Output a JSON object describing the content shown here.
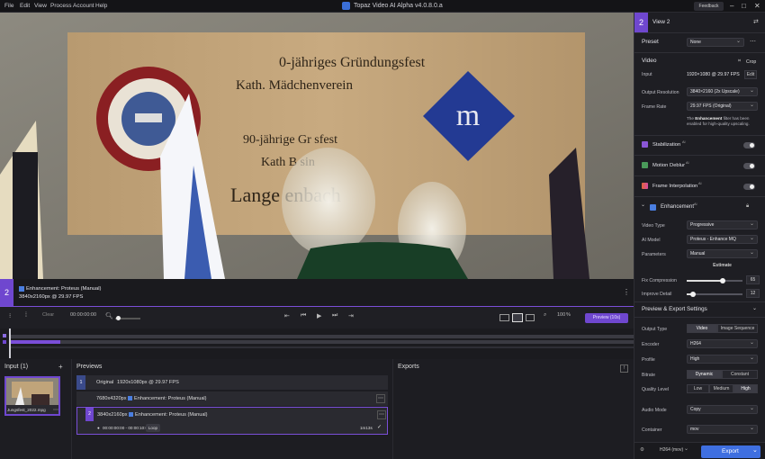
{
  "menu": [
    "File",
    "Edit",
    "View",
    "Process",
    "Account",
    "Help"
  ],
  "app_title": "Topaz Video AI Alpha  v4.0.8.0.a",
  "feedback_label": "Feedback",
  "info_bar": {
    "number": "2",
    "model_line": "Enhancement: Proteus (Manual)",
    "res_line": "3840x2160px @ 29.97 FPS"
  },
  "controls": {
    "clear_label": "Clear",
    "timecode": "00:00:00:00",
    "zoom": "100",
    "zoom_unit": "%",
    "preview_button": "Preview (10s)"
  },
  "timeline": {
    "progress": 0.082
  },
  "input_panel": {
    "title": "Input (1)",
    "file_name": "Jungsfest_2022.mpg"
  },
  "previews_panel": {
    "title": "Previews",
    "original": {
      "num": "1",
      "label": "Original",
      "res": "1920x1080px @ 29.97 FPS"
    },
    "rows": [
      {
        "res": "7680x4320px",
        "model": "Enhancement: Proteus (Manual)"
      },
      {
        "num": "2",
        "res": "3840x2160px",
        "model": "Enhancement: Proteus (Manual)",
        "range": "00:00:00:00 - 00:00:10:00",
        "loop": "Loop",
        "duration": "1m13s"
      }
    ]
  },
  "exports_panel": {
    "title": "Exports"
  },
  "scene_text": {
    "line1": "0-jähriges Gründungsfest",
    "line2": "Kath. Mädchenverein",
    "line3": "90-jährige  Gr          sfest",
    "line4": "Kath  B              sin",
    "line5": "Lange          enbach"
  },
  "right": {
    "view_num": "2",
    "view_title": "View 2",
    "preset_label": "Preset",
    "preset_value": "None",
    "video_label": "Video",
    "crop_label": "Crop",
    "input_label": "Input",
    "input_value": "1920×1080 @ 29.97 FPS",
    "edit_label": "Edit",
    "output_res_label": "Output Resolution",
    "output_res_value": "3840×2160 (2x Upscale)",
    "frame_rate_label": "Frame Rate",
    "frame_rate_value": "29.97 FPS (Original)",
    "note_pre": "The ",
    "note_bold": "Enhancement",
    "note_post": " filter has been",
    "note_line2": "enabled for high-quality upscaling.",
    "stabilization": "Stabilization",
    "motion_deblur": "Motion Deblur",
    "frame_interp": "Frame Interpolation",
    "ai_tag": "AI",
    "enhancement": "Enhancement",
    "video_type_label": "Video Type",
    "video_type_value": "Progressive",
    "ai_model_label": "AI Model",
    "ai_model_value": "Proteus - Enhance MQ",
    "parameters_label": "Parameters",
    "parameters_value": "Manual",
    "estimate_label": "Estimate",
    "fix_comp_label": "Fix Compression",
    "fix_comp_value": "65",
    "improve_detail_label": "Improve Detail",
    "improve_detail_value": "12",
    "preview_export_title": "Preview & Export Settings",
    "output_type_label": "Output Type",
    "output_type_options": [
      "Video",
      "Image Sequence"
    ],
    "encoder_label": "Encoder",
    "encoder_value": "H264",
    "profile_label": "Profile",
    "profile_value": "High",
    "bitrate_label": "Bitrate",
    "bitrate_options": [
      "Dynamic",
      "Constant"
    ],
    "quality_label": "Quality Level",
    "quality_options": [
      "Low",
      "Medium",
      "High"
    ],
    "audio_label": "Audio Mode",
    "audio_value": "Copy",
    "container_label": "Container",
    "container_value": "mov",
    "export_format": "H264 (mov)",
    "export_button": "Export"
  },
  "colors": {
    "accent": "#6f47cf",
    "export_blue": "#3f6fe0"
  }
}
